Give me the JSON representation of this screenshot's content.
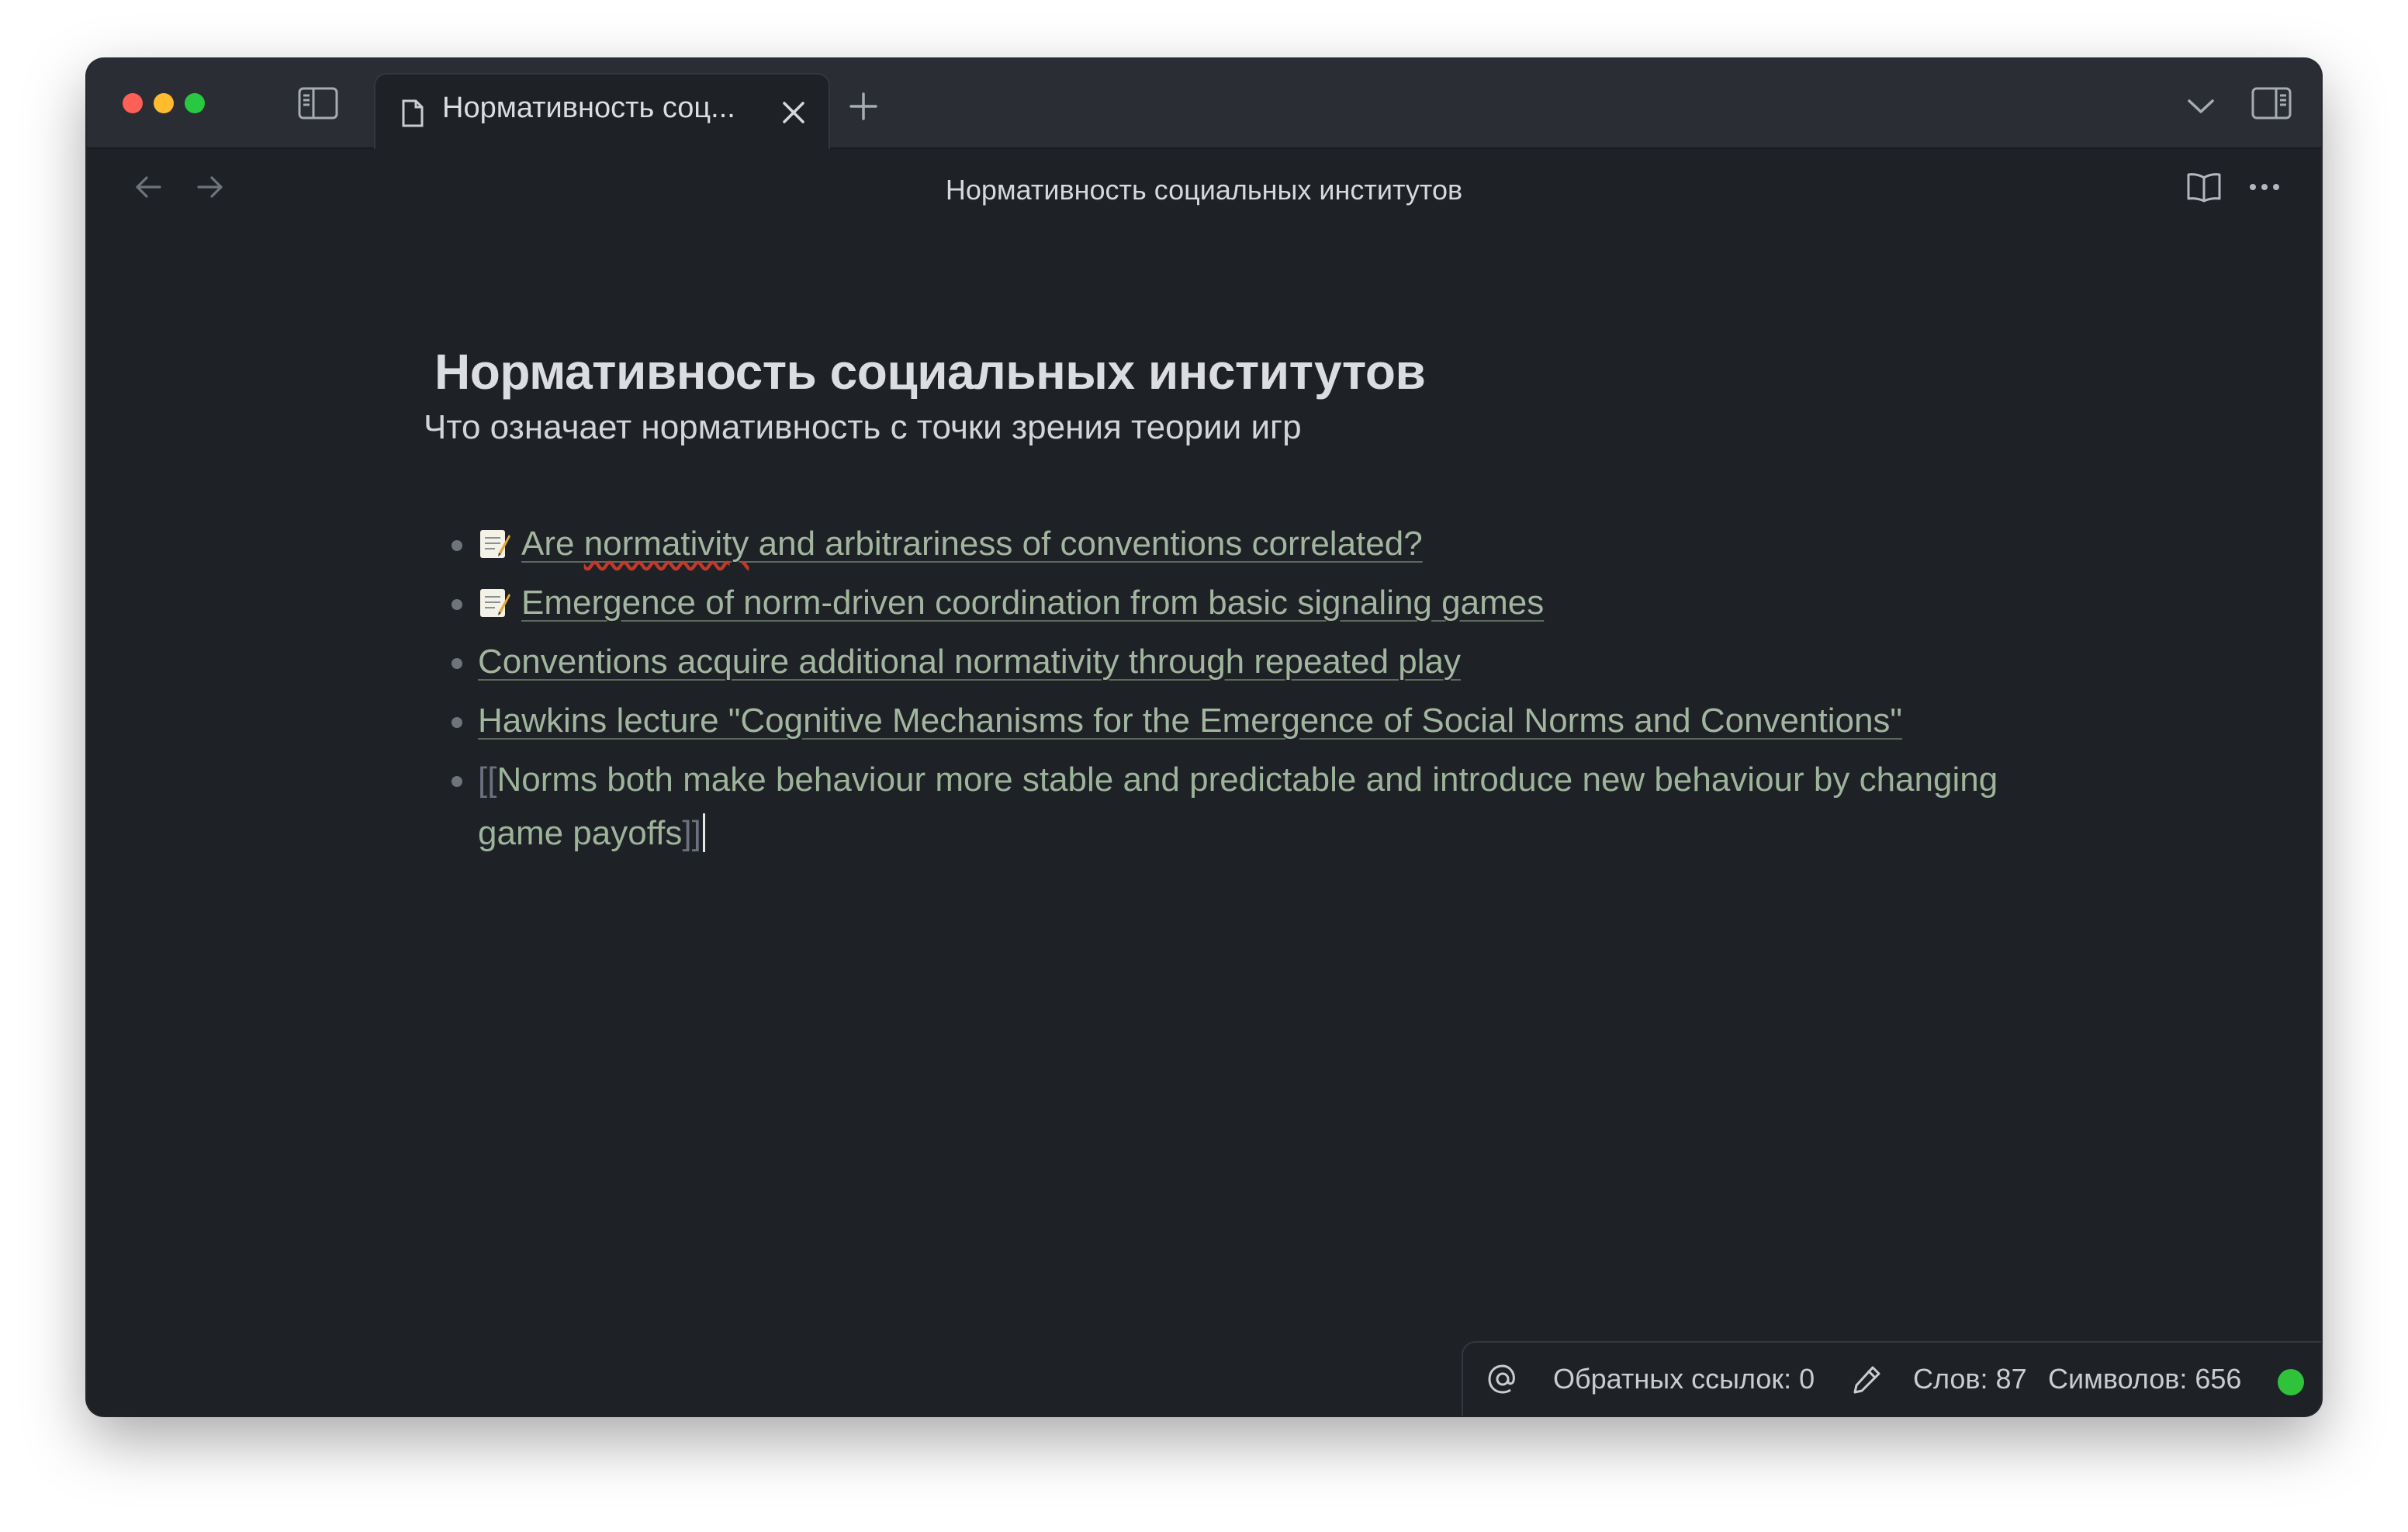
{
  "tab": {
    "label": "Нормативность соц..."
  },
  "nav": {
    "title": "Нормативность социальных институтов"
  },
  "document": {
    "title": "Нормативность социальных институтов",
    "subtitle": "Что означает нормативность с точки зрения теории игр",
    "items": [
      {
        "emoji": "memo",
        "text_before_spell": "Are ",
        "spell": "normativity",
        "text_after": " and arbitrariness of conventions correlated?"
      },
      {
        "emoji": "memo",
        "text": "Emergence of norm-driven coordination from basic signaling games"
      },
      {
        "text": "Conventions acquire additional normativity through repeated play"
      },
      {
        "text": "Hawkins lecture \"Cognitive Mechanisms for the Emergence of Social Norms and Conventions\""
      },
      {
        "open": "[[",
        "text": "Norms both make behaviour more stable and predictable and introduce new behaviour by changing game payoffs",
        "close": "]]"
      }
    ]
  },
  "statusbar": {
    "backlinks": "Обратных ссылок: 0",
    "words": "Слов: 87",
    "chars": "Символов: 656",
    "sync_color": "#2fc23a"
  },
  "icons": {
    "sidebar_toggle": "sidebar-left-icon",
    "tab_file": "file-icon",
    "tab_close": "close-icon",
    "new_tab": "plus-icon",
    "dropdown": "chevron-down-icon",
    "right_sidebar": "sidebar-right-icon",
    "back": "arrow-left-icon",
    "forward": "arrow-right-icon",
    "reading_view": "book-open-icon",
    "more": "more-horizontal-icon",
    "backlinks": "at-sign-icon",
    "edit": "pencil-icon"
  }
}
